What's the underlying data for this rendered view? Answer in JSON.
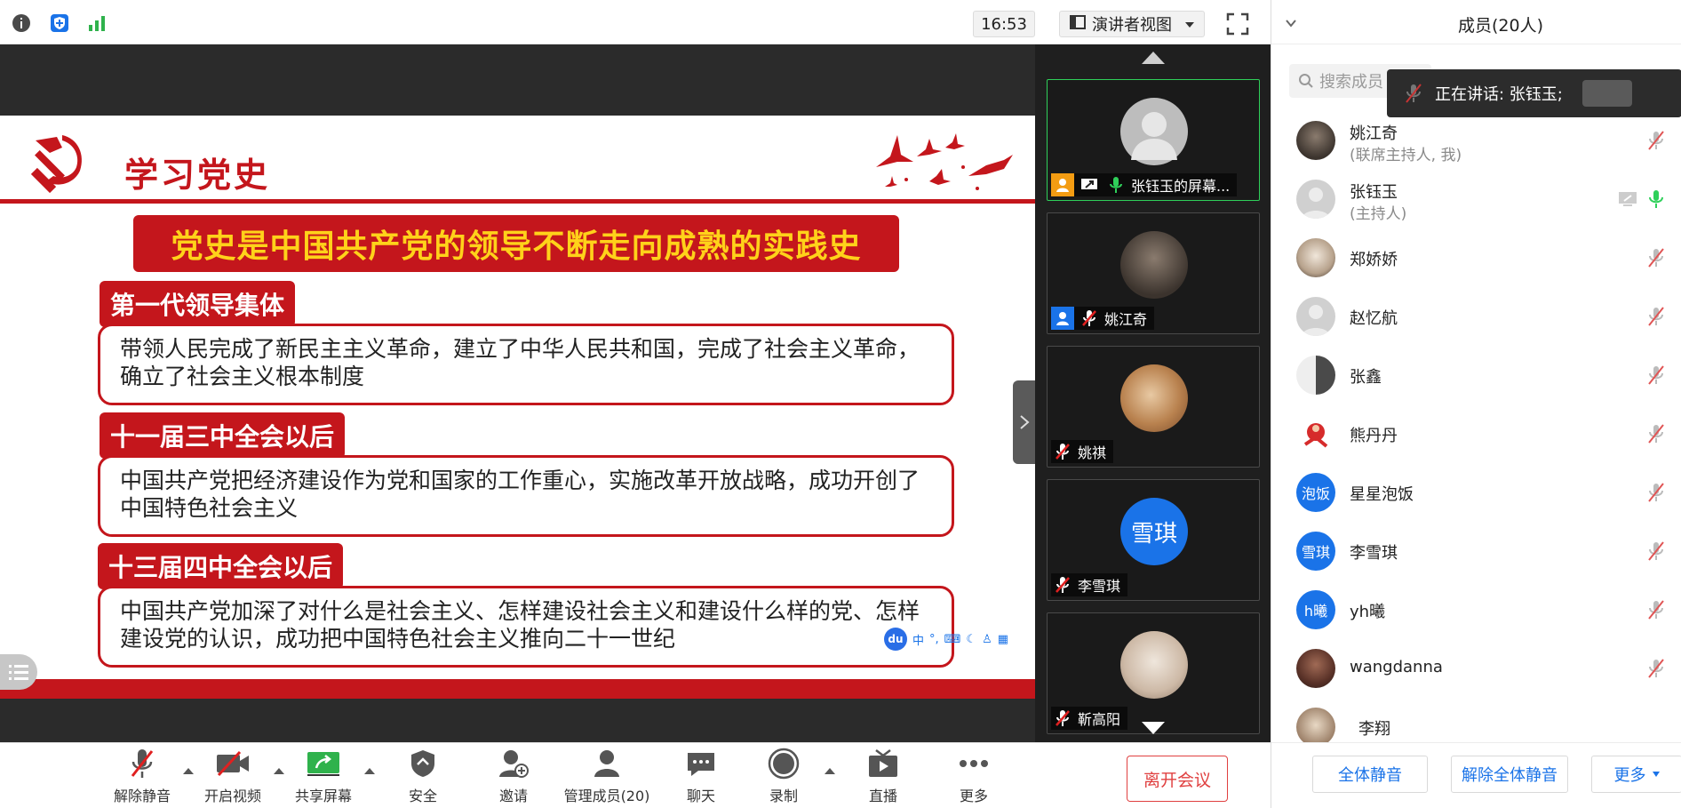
{
  "topbar": {
    "icons": [
      "info-icon",
      "shield-icon",
      "signal-icon"
    ],
    "time": "16:53",
    "view_mode": "演讲者视图",
    "view_mode_icon": "presenter-view-icon",
    "fullscreen_icon": "fullscreen-icon"
  },
  "slide": {
    "title": "学习党史",
    "banner": "党史是中国共产党的领导不断走向成熟的实践史",
    "sections": [
      {
        "tag": "第一代领导集体",
        "text": "带领人民完成了新民主主义革命，建立了中华人民共和国，完成了社会主义革命，确立了社会主义根本制度"
      },
      {
        "tag": "十一届三中全会以后",
        "text": "中国共产党把经济建设作为党和国家的工作重心，实施改革开放战略，成功开创了中国特色社会主义"
      },
      {
        "tag": "十三届四中全会以后",
        "text": "中国共产党加深了对什么是社会主义、怎样建设社会主义和建设什么样的党、怎样建设党的认识，成功把中国特色社会主义推向二十一世纪"
      }
    ],
    "ime_logo": "du",
    "ime_lang": "中"
  },
  "video_tiles": [
    {
      "name": "张钰玉的屏幕...",
      "active": true
    },
    {
      "name": "姚江奇",
      "active": false
    },
    {
      "name": "姚祺",
      "active": false
    },
    {
      "name": "李雪琪",
      "avatar_text": "雪琪",
      "active": false
    },
    {
      "name": "靳高阳",
      "active": false
    }
  ],
  "toolbar": {
    "unmute": "解除静音",
    "start_video": "开启视频",
    "share_screen": "共享屏幕",
    "security": "安全",
    "invite": "邀请",
    "manage_members": "管理成员(20)",
    "chat": "聊天",
    "record": "录制",
    "live": "直播",
    "more": "更多",
    "leave": "离开会议"
  },
  "panel": {
    "title": "成员(20人)",
    "search_placeholder": "搜索成员",
    "speaking": "正在讲话: 张钰玉;",
    "members": [
      {
        "name": "姚江奇",
        "role": "(联席主持人, 我)",
        "avatar": "photo"
      },
      {
        "name": "张钰玉",
        "role": "(主持人)",
        "avatar": "gray"
      },
      {
        "name": "郑娇娇",
        "role": "",
        "avatar": "photo"
      },
      {
        "name": "赵忆航",
        "role": "",
        "avatar": "gray"
      },
      {
        "name": "张鑫",
        "role": "",
        "avatar": "photo"
      },
      {
        "name": "熊丹丹",
        "role": "",
        "avatar": "photo"
      },
      {
        "name": "星星泡饭",
        "role": "",
        "avatar_text": "泡饭"
      },
      {
        "name": "李雪琪",
        "role": "",
        "avatar_text": "雪琪"
      },
      {
        "name": "yh曦",
        "role": "",
        "avatar_text": "h曦"
      },
      {
        "name": "wangdanna",
        "role": "",
        "avatar": "photo"
      },
      {
        "name": "李翔",
        "role": "",
        "avatar": "photo"
      }
    ],
    "mute_all": "全体静音",
    "unmute_all": "解除全体静音",
    "more": "更多"
  },
  "colors": {
    "accent_red": "#c4161c",
    "banner_text": "#ffd21a",
    "brand_blue": "#1a73e8",
    "speaking_green": "#2fd05a"
  }
}
